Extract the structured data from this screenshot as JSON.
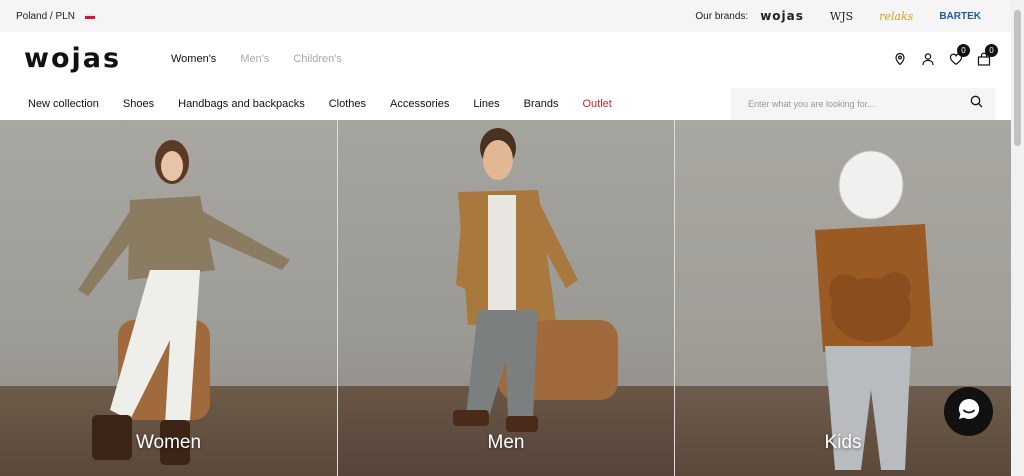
{
  "topbar": {
    "region": "Poland / PLN",
    "brands_label": "Our brands:",
    "brands": [
      "wojas",
      "WJS",
      "relaks",
      "BARTEK"
    ]
  },
  "header": {
    "logo": "wojas",
    "gender_tabs": [
      {
        "label": "Women's",
        "active": true
      },
      {
        "label": "Men's",
        "active": false
      },
      {
        "label": "Children's",
        "active": false
      }
    ],
    "wishlist_count": "0",
    "cart_count": "0"
  },
  "nav": {
    "items": [
      "New collection",
      "Shoes",
      "Handbags and backpacks",
      "Clothes",
      "Accessories",
      "Lines",
      "Brands",
      "Outlet"
    ]
  },
  "search": {
    "placeholder": "Enter what you are looking for..."
  },
  "hero": {
    "panels": [
      {
        "label": "Women"
      },
      {
        "label": "Men"
      },
      {
        "label": "Kids"
      }
    ]
  },
  "colors": {
    "outlet": "#c62828",
    "brand_relaks": "#d4a017",
    "brand_bartek": "#1e5aa8"
  }
}
